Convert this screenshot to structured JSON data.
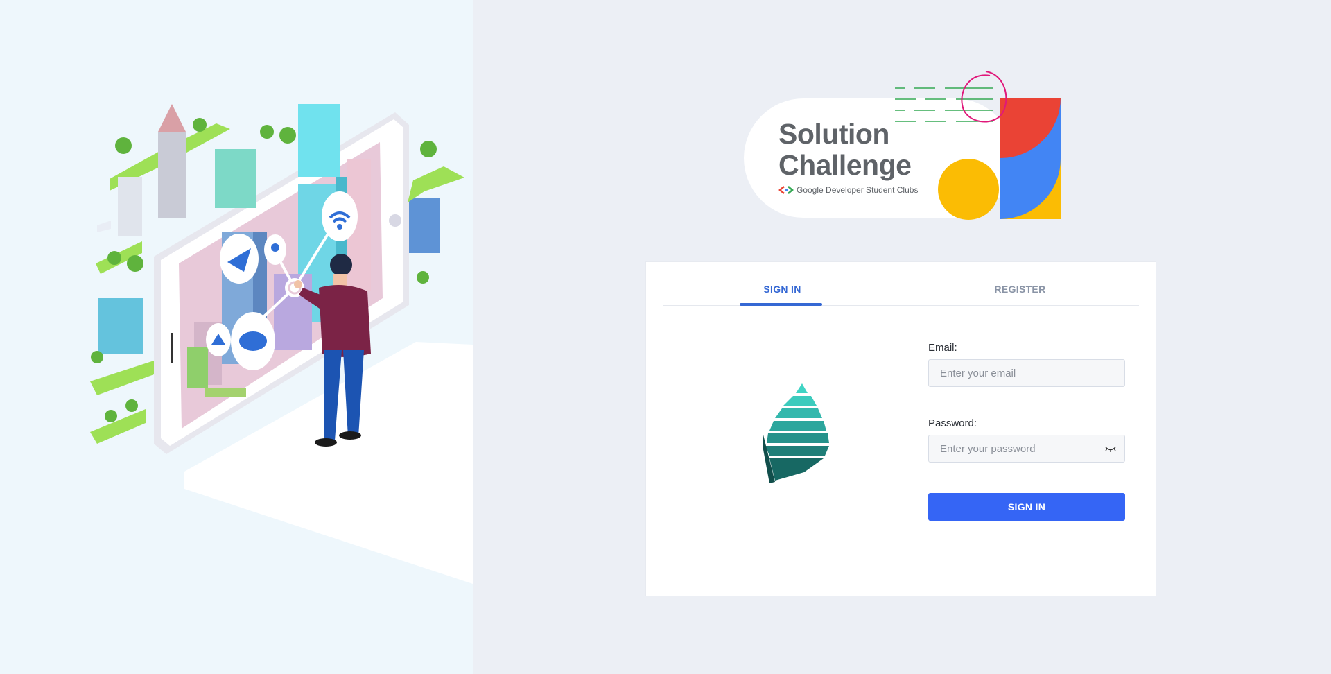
{
  "banner": {
    "title_line1": "Solution",
    "title_line2": "Challenge",
    "subtitle": "Google Developer Student Clubs"
  },
  "tabs": [
    {
      "label": "SIGN IN",
      "active": true
    },
    {
      "label": "REGISTER",
      "active": false
    }
  ],
  "form": {
    "email_label": "Email:",
    "email_placeholder": "Enter your email",
    "password_label": "Password:",
    "password_placeholder": "Enter your password",
    "submit_label": "SIGN IN"
  },
  "icons": {
    "password_toggle": "eye-closed-icon",
    "logo": "layered-pyramid-logo"
  },
  "colors": {
    "primary": "#3565f5",
    "tab_active": "#3568d4",
    "google_red": "#ea4335",
    "google_blue": "#4285f4",
    "google_yellow": "#fbbc04",
    "google_green": "#34a853",
    "logo_teal": "#2ec4b6"
  }
}
